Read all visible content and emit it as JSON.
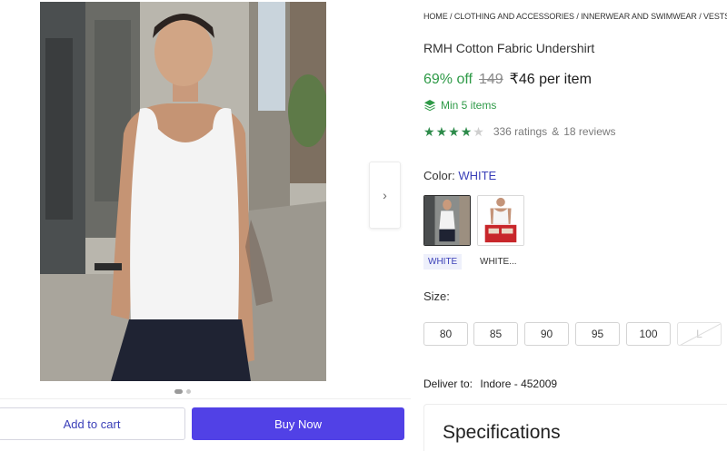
{
  "breadcrumb": {
    "items": [
      "HOME",
      "CLOTHING AND ACCESSORIES",
      "INNERWEAR AND SWIMWEAR",
      "VESTS"
    ],
    "separator": " / ",
    "trailing": " /"
  },
  "product": {
    "title": "RMH Cotton Fabric Undershirt",
    "discount": "69% off",
    "mrp": "149",
    "price": "₹46 per item",
    "min_order": "Min 5 items",
    "rating": {
      "stars": 4,
      "out_of": 5,
      "ratings_text": "336 ratings",
      "separator": "&",
      "reviews_text": "18 reviews"
    }
  },
  "gallery": {
    "active_index": 0,
    "count": 2,
    "next_icon": "chevron-right-icon"
  },
  "color": {
    "label": "Color:",
    "selected": "WHITE",
    "options": [
      {
        "name": "WHITE",
        "selected": true
      },
      {
        "name": "WHITE...",
        "selected": false
      }
    ]
  },
  "size": {
    "label": "Size:",
    "options": [
      {
        "value": "80",
        "available": true
      },
      {
        "value": "85",
        "available": true
      },
      {
        "value": "90",
        "available": true
      },
      {
        "value": "95",
        "available": true
      },
      {
        "value": "100",
        "available": true
      },
      {
        "value": "L",
        "available": false
      }
    ]
  },
  "delivery": {
    "label": "Deliver to:",
    "location": "Indore - 452009"
  },
  "specifications": {
    "title": "Specifications"
  },
  "actions": {
    "add_to_cart": "Add to cart",
    "buy_now": "Buy Now"
  },
  "colors": {
    "accent": "#5141e6",
    "link": "#3a3fb8",
    "success": "#2e9a47",
    "star": "#2d8b4a"
  }
}
